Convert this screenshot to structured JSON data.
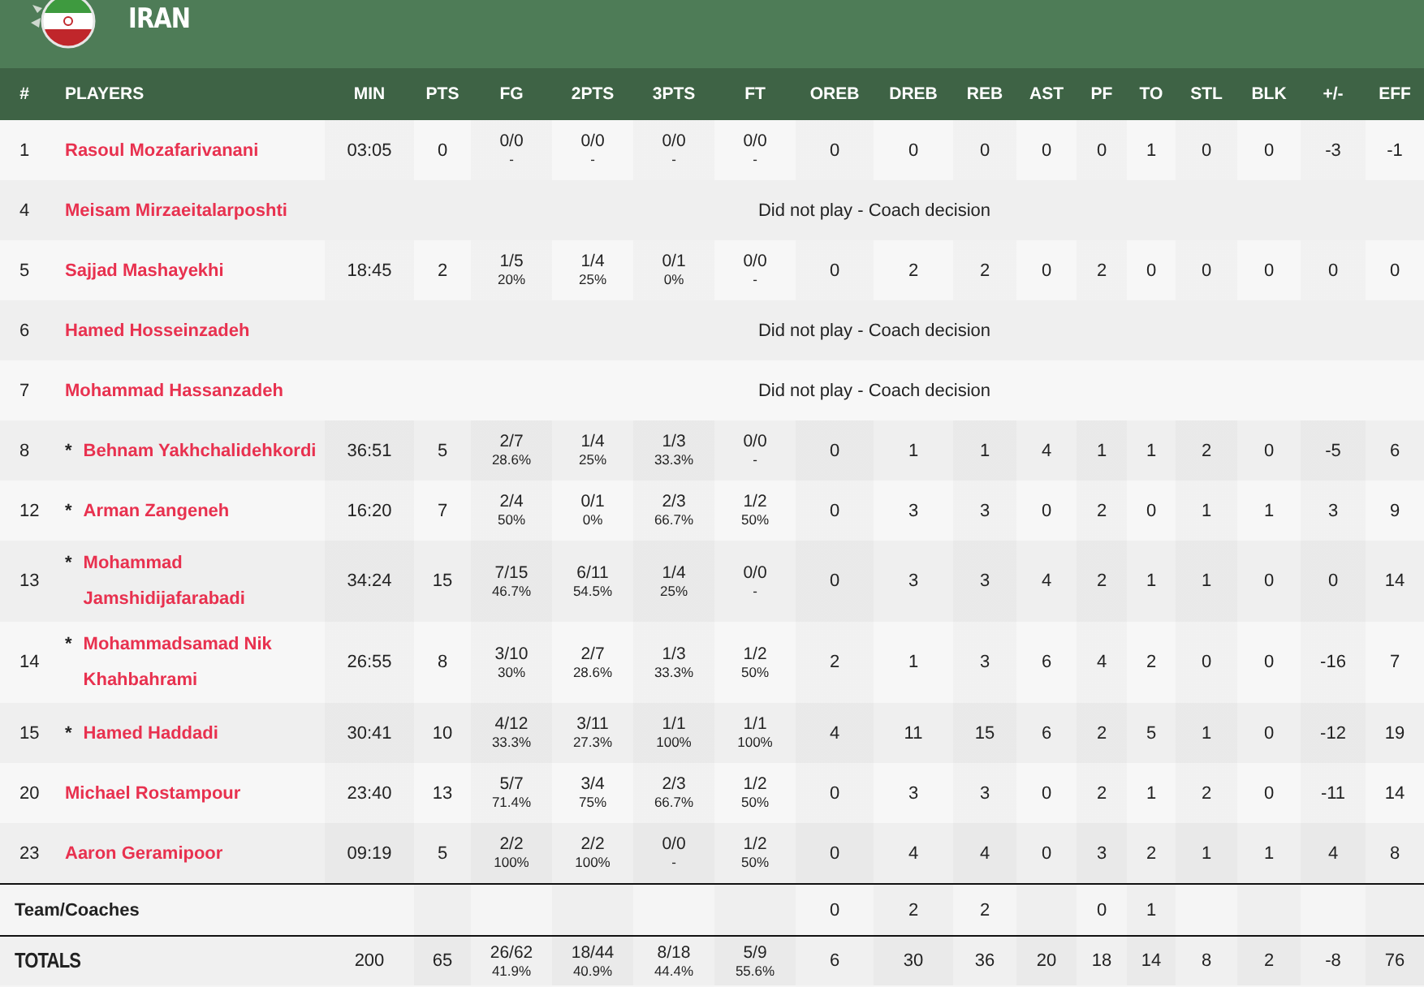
{
  "team": {
    "name": "IRAN"
  },
  "table": {
    "columns": [
      "#",
      "PLAYERS",
      "MIN",
      "PTS",
      "FG",
      "2PTS",
      "3PTS",
      "FT",
      "OREB",
      "DREB",
      "REB",
      "AST",
      "PF",
      "TO",
      "STL",
      "BLK",
      "+/-",
      "EFF"
    ],
    "rows": [
      {
        "kind": "player",
        "num": "1",
        "name": "Rasoul Mozafarivanani",
        "stats": [
          "03:05",
          "0",
          {
            "made": "0/0",
            "pct": "-"
          },
          {
            "made": "0/0",
            "pct": "-"
          },
          {
            "made": "0/0",
            "pct": "-"
          },
          {
            "made": "0/0",
            "pct": "-"
          },
          "0",
          "0",
          "0",
          "0",
          "0",
          "1",
          "0",
          "0",
          "-3",
          "-1"
        ]
      },
      {
        "kind": "dnp",
        "num": "4",
        "name": "Meisam Mirzaeitalarposhti",
        "note": "Did not play - Coach decision"
      },
      {
        "kind": "player",
        "num": "5",
        "name": "Sajjad Mashayekhi",
        "stats": [
          "18:45",
          "2",
          {
            "made": "1/5",
            "pct": "20%"
          },
          {
            "made": "1/4",
            "pct": "25%"
          },
          {
            "made": "0/1",
            "pct": "0%"
          },
          {
            "made": "0/0",
            "pct": "-"
          },
          "0",
          "2",
          "2",
          "0",
          "2",
          "0",
          "0",
          "0",
          "0",
          "0"
        ]
      },
      {
        "kind": "dnp",
        "num": "6",
        "name": "Hamed Hosseinzadeh",
        "note": "Did not play - Coach decision"
      },
      {
        "kind": "dnp",
        "num": "7",
        "name": "Mohammad Hassanzadeh",
        "note": "Did not play - Coach decision"
      },
      {
        "kind": "player",
        "num": "8",
        "starter_mark": "*",
        "name": "Behnam Yakhchalidehkordi",
        "stats": [
          "36:51",
          "5",
          {
            "made": "2/7",
            "pct": "28.6%"
          },
          {
            "made": "1/4",
            "pct": "25%"
          },
          {
            "made": "1/3",
            "pct": "33.3%"
          },
          {
            "made": "0/0",
            "pct": "-"
          },
          "0",
          "1",
          "1",
          "4",
          "1",
          "1",
          "2",
          "0",
          "-5",
          "6"
        ]
      },
      {
        "kind": "player",
        "num": "12",
        "starter_mark": "*",
        "name": "Arman Zangeneh",
        "stats": [
          "16:20",
          "7",
          {
            "made": "2/4",
            "pct": "50%"
          },
          {
            "made": "0/1",
            "pct": "0%"
          },
          {
            "made": "2/3",
            "pct": "66.7%"
          },
          {
            "made": "1/2",
            "pct": "50%"
          },
          "0",
          "3",
          "3",
          "0",
          "2",
          "0",
          "1",
          "1",
          "3",
          "9"
        ]
      },
      {
        "kind": "player",
        "num": "13",
        "starter_mark": "*",
        "name": "Mohammad Jamshidijafarabadi",
        "stats": [
          "34:24",
          "15",
          {
            "made": "7/15",
            "pct": "46.7%"
          },
          {
            "made": "6/11",
            "pct": "54.5%"
          },
          {
            "made": "1/4",
            "pct": "25%"
          },
          {
            "made": "0/0",
            "pct": "-"
          },
          "0",
          "3",
          "3",
          "4",
          "2",
          "1",
          "1",
          "0",
          "0",
          "14"
        ]
      },
      {
        "kind": "player",
        "num": "14",
        "starter_mark": "*",
        "name": "Mohammadsamad Nik Khahbahrami",
        "stats": [
          "26:55",
          "8",
          {
            "made": "3/10",
            "pct": "30%"
          },
          {
            "made": "2/7",
            "pct": "28.6%"
          },
          {
            "made": "1/3",
            "pct": "33.3%"
          },
          {
            "made": "1/2",
            "pct": "50%"
          },
          "2",
          "1",
          "3",
          "6",
          "4",
          "2",
          "0",
          "0",
          "-16",
          "7"
        ]
      },
      {
        "kind": "player",
        "num": "15",
        "starter_mark": "*",
        "name": "Hamed Haddadi",
        "stats": [
          "30:41",
          "10",
          {
            "made": "4/12",
            "pct": "33.3%"
          },
          {
            "made": "3/11",
            "pct": "27.3%"
          },
          {
            "made": "1/1",
            "pct": "100%"
          },
          {
            "made": "1/1",
            "pct": "100%"
          },
          "4",
          "11",
          "15",
          "6",
          "2",
          "5",
          "1",
          "0",
          "-12",
          "19"
        ]
      },
      {
        "kind": "player",
        "num": "20",
        "name": "Michael Rostampour",
        "stats": [
          "23:40",
          "13",
          {
            "made": "5/7",
            "pct": "71.4%"
          },
          {
            "made": "3/4",
            "pct": "75%"
          },
          {
            "made": "2/3",
            "pct": "66.7%"
          },
          {
            "made": "1/2",
            "pct": "50%"
          },
          "0",
          "3",
          "3",
          "0",
          "2",
          "1",
          "2",
          "0",
          "-11",
          "14"
        ]
      },
      {
        "kind": "player",
        "num": "23",
        "name": "Aaron Geramipoor",
        "stats": [
          "09:19",
          "5",
          {
            "made": "2/2",
            "pct": "100%"
          },
          {
            "made": "2/2",
            "pct": "100%"
          },
          {
            "made": "0/0",
            "pct": "-"
          },
          {
            "made": "1/2",
            "pct": "50%"
          },
          "0",
          "4",
          "4",
          "0",
          "3",
          "2",
          "1",
          "1",
          "4",
          "8"
        ]
      },
      {
        "kind": "team",
        "name": "Team/Coaches",
        "stats": [
          {
            "kind": "empty"
          },
          {
            "kind": "empty"
          },
          {
            "kind": "empty"
          },
          {
            "kind": "empty"
          },
          {
            "kind": "empty"
          },
          {
            "kind": "empty"
          },
          {
            "kind": "stat",
            "text": "0"
          },
          {
            "kind": "stat",
            "text": "2"
          },
          {
            "kind": "stat",
            "text": "2"
          },
          {
            "kind": "empty"
          },
          {
            "kind": "stat",
            "text": "0"
          },
          {
            "kind": "stat",
            "text": "1"
          },
          {
            "kind": "empty"
          },
          {
            "kind": "empty"
          },
          {
            "kind": "empty"
          },
          {
            "kind": "empty"
          }
        ]
      },
      {
        "kind": "totals",
        "name": "TOTALS",
        "stats": [
          "200",
          "65",
          {
            "made": "26/62",
            "pct": "41.9%"
          },
          {
            "made": "18/44",
            "pct": "40.9%"
          },
          {
            "made": "8/18",
            "pct": "44.4%"
          },
          {
            "made": "5/9",
            "pct": "55.6%"
          },
          "6",
          "30",
          "36",
          "20",
          "18",
          "14",
          "8",
          "2",
          "-8",
          "76"
        ]
      }
    ]
  }
}
